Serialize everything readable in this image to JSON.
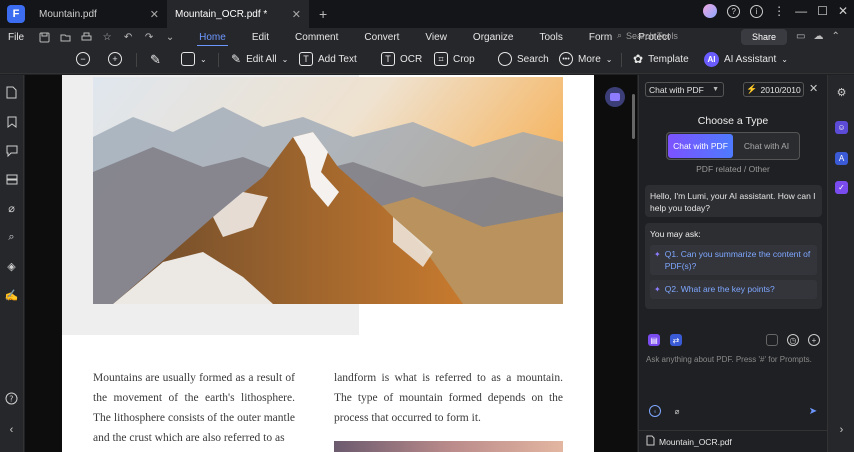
{
  "app": {
    "logo_glyph": "F"
  },
  "tabs": [
    {
      "title": "Mountain.pdf",
      "close": "✕",
      "active": false
    },
    {
      "title": "Mountain_OCR.pdf *",
      "close": "✕",
      "active": true
    }
  ],
  "tab_add": "+",
  "window": {
    "help": "?",
    "info": "i",
    "more": "⋮",
    "minimize": "—",
    "maximize": "☐",
    "close": "✕"
  },
  "menu": {
    "file": "File",
    "items": [
      "Home",
      "Edit",
      "Comment",
      "Convert",
      "View",
      "Organize",
      "Tools",
      "Form",
      "Protect"
    ],
    "active": "Home",
    "search_placeholder": "Search Tools",
    "share": "Share"
  },
  "toolbar": {
    "edit_all": "Edit All",
    "add_text": "Add Text",
    "ocr": "OCR",
    "crop": "Crop",
    "search": "Search",
    "more": "More",
    "template": "Template",
    "ai_assistant": "AI Assistant",
    "ai_badge": "AI"
  },
  "document": {
    "col1": "Mountains are usually formed as a result of the movement of the earth's lithosphere. The lithosphere consists of the outer mantle and the crust which are also referred to as",
    "col2": "landform is what is referred to as a mountain. The type of mountain formed depends on the process that occurred to form it."
  },
  "ai_panel": {
    "mode_select": "Chat with PDF",
    "credits": "2010/2010",
    "close": "✕",
    "choose_title": "Choose a Type",
    "type_pdf": "Chat with PDF",
    "type_ai": "Chat with AI",
    "pdf_related": "PDF related / Other",
    "greeting": "Hello, I'm Lumi, your AI assistant. How can I help you today?",
    "you_may_ask": "You may ask:",
    "questions": [
      "Q1. Can you summarize the content of PDF(s)?",
      "Q2. What are the key points?"
    ],
    "input_placeholder": "Ask anything about PDF. Press '#' for Prompts.",
    "file_name": "Mountain_OCR.pdf"
  },
  "colors": {
    "accent": "#6d97ff",
    "ai_purple": "#7c52ff",
    "ai_blue": "#4e7bff"
  }
}
